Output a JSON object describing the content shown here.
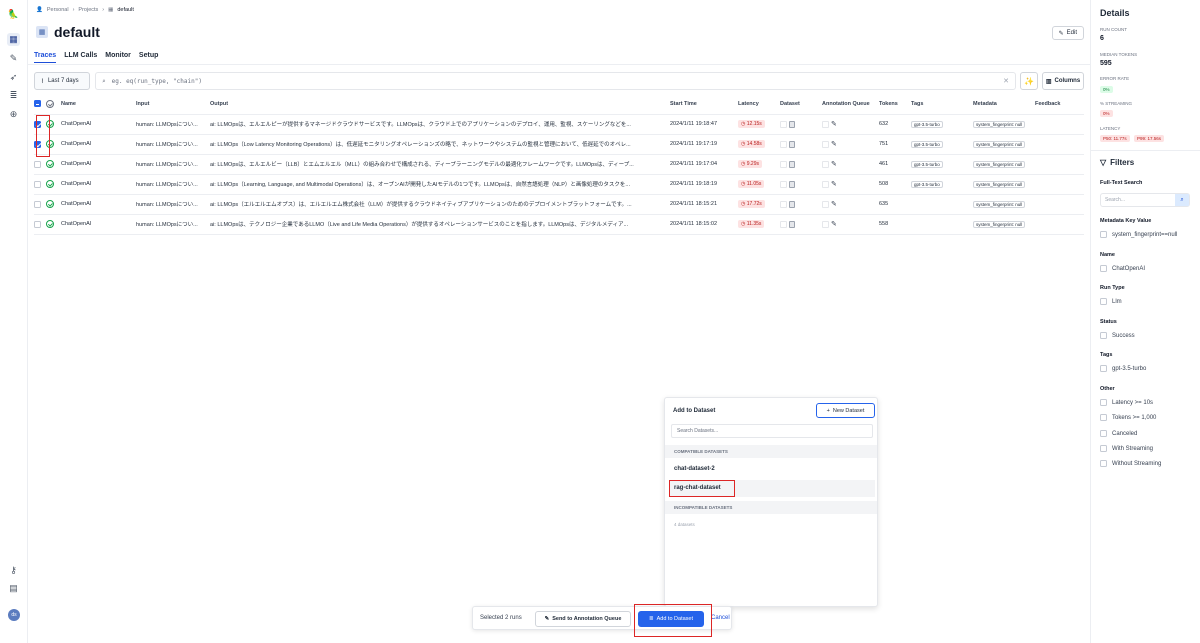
{
  "rail": {
    "icons": [
      "logo-icon",
      "grid-icon",
      "pen-icon",
      "rocket-icon",
      "database-icon",
      "plus-circle-icon",
      "key-icon",
      "doc-icon"
    ],
    "avatar": "ds"
  },
  "breadcrumb": {
    "root": "Personal",
    "projects": "Projects",
    "current": "default"
  },
  "page": {
    "title": "default",
    "edit_label": "Edit"
  },
  "tabs": [
    {
      "label": "Traces",
      "active": true
    },
    {
      "label": "LLM Calls",
      "active": false
    },
    {
      "label": "Monitor",
      "active": false
    },
    {
      "label": "Setup",
      "active": false
    }
  ],
  "filters_bar": {
    "date_label": "Last 7 days",
    "search_placeholder": "eg. eq(run_type, \"chain\")",
    "columns_label": "Columns"
  },
  "table": {
    "headers": [
      "Name",
      "Input",
      "Output",
      "Start Time",
      "Latency",
      "Dataset",
      "Annotation Queue",
      "Tokens",
      "Tags",
      "Metadata",
      "Feedback"
    ],
    "rows": [
      {
        "checked": true,
        "name": "ChatOpenAI",
        "input": "human: LLMOpsについ...",
        "output": "ai: LLMOpsは、エルエルピーが提供するマネージドクラウドサービスです。LLMOpsは、クラウド上でのアプリケーションのデプロイ、運用、監視、スケーリングなどを...",
        "start": "2024/1/11 19:18:47",
        "latency": "12.15s",
        "tokens": "632",
        "tag": "gpt-3.5-turbo",
        "meta": "system_fingerprint: null"
      },
      {
        "checked": true,
        "name": "ChatOpenAI",
        "input": "human: LLMOpsについ...",
        "output": "ai: LLMOps（Low Latency Monitoring Operations）は、低遅延モニタリングオペレーションズの略で、ネットワークやシステムの監視と管理において、低遅延でのオペレ...",
        "start": "2024/1/11 19:17:19",
        "latency": "14.58s",
        "tokens": "751",
        "tag": "gpt-3.5-turbo",
        "meta": "system_fingerprint: null"
      },
      {
        "checked": false,
        "name": "ChatOpenAI",
        "input": "human: LLMOpsについ...",
        "output": "ai: LLMOpsは、エルエルビー（LLB）とエムエルエル（MLL）の組み合わせで構成される、ディープラーニングモデルの最適化フレームワークです。LLMOpsは、ディープ...",
        "start": "2024/1/11 19:17:04",
        "latency": "9.29s",
        "tokens": "461",
        "tag": "gpt-3.5-turbo",
        "meta": "system_fingerprint: null"
      },
      {
        "checked": false,
        "name": "ChatOpenAI",
        "input": "human: LLMOpsについ...",
        "output": "ai: LLMOps（Learning, Language, and Multimodal Operations）は、オープンAIが開発したAIモデルの1つです。LLMOpsは、自然言語処理（NLP）と画像処理のタスクを...",
        "start": "2024/1/11 19:18:19",
        "latency": "11.05s",
        "tokens": "508",
        "tag": "gpt-3.5-turbo",
        "meta": "system_fingerprint: null"
      },
      {
        "checked": false,
        "name": "ChatOpenAI",
        "input": "human: LLMOpsについ...",
        "output": "ai: LLMOps（エルエルエムオプス）は、エルエルエム株式会社（LLM）が提供するクラウドネイティブアプリケーションのためのデプロイメントプラットフォームです。...",
        "start": "2024/1/11 18:15:21",
        "latency": "17.72s",
        "tokens": "635",
        "tag": "",
        "meta": "system_fingerprint: null"
      },
      {
        "checked": false,
        "name": "ChatOpenAI",
        "input": "human: LLMOpsについ...",
        "output": "ai: LLMOpsは、テクノロジー企業であるLLMO（Live and Life Media Operations）が提供するオペレーションサービスのことを指します。LLMOpsは、デジタルメディア...",
        "start": "2024/1/11 18:15:02",
        "latency": "11.35s",
        "tokens": "558",
        "tag": "",
        "meta": "system_fingerprint: null"
      }
    ]
  },
  "details": {
    "title": "Details",
    "run_count_label": "RUN COUNT",
    "run_count": "6",
    "median_tokens_label": "MEDIAN TOKENS",
    "median_tokens": "595",
    "error_rate_label": "ERROR RATE",
    "error_rate": "0%",
    "streaming_label": "% STREAMING",
    "streaming": "0%",
    "latency_label": "LATENCY",
    "p50": "P50: 11.77s",
    "p99": "P99: 17.56s"
  },
  "filters": {
    "title": "Filters",
    "fulltext_label": "Full-Text Search",
    "search_placeholder": "Search...",
    "metadata_label": "Metadata Key Value",
    "metadata_opt": "system_fingerprint==null",
    "name_label": "Name",
    "name_opt": "ChatOpenAI",
    "runtype_label": "Run Type",
    "runtype_opt": "Llm",
    "status_label": "Status",
    "status_opt": "Success",
    "tags_label": "Tags",
    "tags_opt": "gpt-3.5-turbo",
    "other_label": "Other",
    "other_opts": [
      "Latency >= 10s",
      "Tokens >= 1,000",
      "Canceled",
      "With Streaming",
      "Without Streaming"
    ]
  },
  "popup": {
    "title": "Add to Dataset",
    "new_label": "New Dataset",
    "search_placeholder": "Search Datasets...",
    "compatible_label": "COMPATIBLE DATASETS",
    "datasets": [
      "chat-dataset-2",
      "rag-chat-dataset"
    ],
    "incompatible_label": "INCOMPATIBLE DATASETS",
    "incompatible_count": "4 datasets"
  },
  "actionbar": {
    "selected": "Selected 2 runs",
    "send_queue": "Send to Annotation Queue",
    "add_dataset": "Add to Dataset",
    "cancel": "Cancel"
  }
}
